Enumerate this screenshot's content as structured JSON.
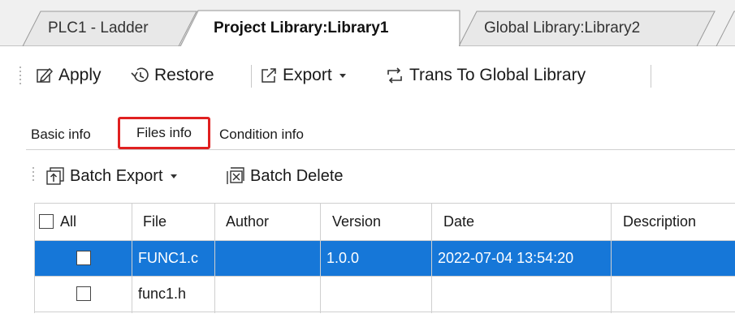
{
  "doc_tabs": [
    {
      "label": "PLC1 - Ladder",
      "active": false
    },
    {
      "label": "Project Library:Library1",
      "active": true
    },
    {
      "label": "Global Library:Library2",
      "active": false
    }
  ],
  "toolbar": {
    "apply_label": "Apply",
    "restore_label": "Restore",
    "export_label": "Export",
    "trans_label": "Trans To Global Library"
  },
  "sub_tabs": [
    {
      "label": "Basic info",
      "active": false
    },
    {
      "label": "Files info",
      "active": true
    },
    {
      "label": "Condition info",
      "active": false
    }
  ],
  "files_toolbar": {
    "batch_export_label": "Batch Export",
    "batch_delete_label": "Batch Delete"
  },
  "table": {
    "columns": [
      "All",
      "File",
      "Author",
      "Version",
      "Date",
      "Description"
    ],
    "rows": [
      {
        "file": "FUNC1.c",
        "author": "",
        "version": "1.0.0",
        "date": "2022-07-04 13:54:20",
        "description": "",
        "selected": true
      },
      {
        "file": "func1.h",
        "author": "",
        "version": "",
        "date": "",
        "description": "",
        "selected": false
      }
    ]
  },
  "colors": {
    "selection": "#1677d8",
    "highlight_border": "#e02020",
    "background": "#f0f0f0"
  },
  "icons": [
    "edit-icon",
    "restore-icon",
    "export-icon",
    "trans-icon",
    "batch-export-icon",
    "batch-delete-icon"
  ]
}
